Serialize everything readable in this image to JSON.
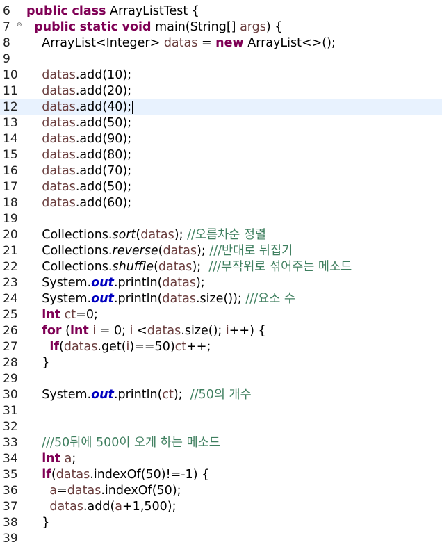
{
  "editor": {
    "current_line": "12",
    "lines": [
      {
        "num": "6",
        "segs": [
          [
            "kw",
            "public"
          ],
          [
            "t",
            " "
          ],
          [
            "kw",
            "class"
          ],
          [
            "t",
            " ArrayListTest {"
          ]
        ]
      },
      {
        "num": "7",
        "fold": true,
        "segs": [
          [
            "t",
            "  "
          ],
          [
            "kw",
            "public"
          ],
          [
            "t",
            " "
          ],
          [
            "kw",
            "static"
          ],
          [
            "t",
            " "
          ],
          [
            "kw",
            "void"
          ],
          [
            "t",
            " main(String[] "
          ],
          [
            "var",
            "args"
          ],
          [
            "t",
            ") {"
          ]
        ]
      },
      {
        "num": "8",
        "segs": [
          [
            "t",
            "    ArrayList<Integer> "
          ],
          [
            "var",
            "datas"
          ],
          [
            "t",
            " = "
          ],
          [
            "kw",
            "new"
          ],
          [
            "t",
            " ArrayList<>();"
          ]
        ]
      },
      {
        "num": "9",
        "segs": []
      },
      {
        "num": "10",
        "segs": [
          [
            "t",
            "    "
          ],
          [
            "var",
            "datas"
          ],
          [
            "t",
            ".add(10);"
          ]
        ]
      },
      {
        "num": "11",
        "segs": [
          [
            "t",
            "    "
          ],
          [
            "var",
            "datas"
          ],
          [
            "t",
            ".add(20);"
          ]
        ]
      },
      {
        "num": "12",
        "current": true,
        "caret": true,
        "segs": [
          [
            "t",
            "    "
          ],
          [
            "var",
            "datas"
          ],
          [
            "t",
            ".add(40);"
          ]
        ]
      },
      {
        "num": "13",
        "segs": [
          [
            "t",
            "    "
          ],
          [
            "var",
            "datas"
          ],
          [
            "t",
            ".add(50);"
          ]
        ]
      },
      {
        "num": "14",
        "segs": [
          [
            "t",
            "    "
          ],
          [
            "var",
            "datas"
          ],
          [
            "t",
            ".add(90);"
          ]
        ]
      },
      {
        "num": "15",
        "segs": [
          [
            "t",
            "    "
          ],
          [
            "var",
            "datas"
          ],
          [
            "t",
            ".add(80);"
          ]
        ]
      },
      {
        "num": "16",
        "segs": [
          [
            "t",
            "    "
          ],
          [
            "var",
            "datas"
          ],
          [
            "t",
            ".add(70);"
          ]
        ]
      },
      {
        "num": "17",
        "segs": [
          [
            "t",
            "    "
          ],
          [
            "var",
            "datas"
          ],
          [
            "t",
            ".add(50);"
          ]
        ]
      },
      {
        "num": "18",
        "segs": [
          [
            "t",
            "    "
          ],
          [
            "var",
            "datas"
          ],
          [
            "t",
            ".add(60);"
          ]
        ]
      },
      {
        "num": "19",
        "segs": []
      },
      {
        "num": "20",
        "segs": [
          [
            "t",
            "    Collections."
          ],
          [
            "sm",
            "sort"
          ],
          [
            "t",
            "("
          ],
          [
            "var",
            "datas"
          ],
          [
            "t",
            ");"
          ],
          [
            "t",
            " "
          ],
          [
            "cm",
            "//오름차순 정렬"
          ]
        ]
      },
      {
        "num": "21",
        "segs": [
          [
            "t",
            "    Collections."
          ],
          [
            "sm",
            "reverse"
          ],
          [
            "t",
            "("
          ],
          [
            "var",
            "datas"
          ],
          [
            "t",
            ");"
          ],
          [
            "t",
            " "
          ],
          [
            "cm",
            "///반대로 뒤집기"
          ]
        ]
      },
      {
        "num": "22",
        "segs": [
          [
            "t",
            "    Collections."
          ],
          [
            "sm",
            "shuffle"
          ],
          [
            "t",
            "("
          ],
          [
            "var",
            "datas"
          ],
          [
            "t",
            ");"
          ],
          [
            "t",
            "  "
          ],
          [
            "cm",
            "///무작위로 섞어주는 메소드"
          ]
        ]
      },
      {
        "num": "23",
        "segs": [
          [
            "t",
            "    System."
          ],
          [
            "fld",
            "out"
          ],
          [
            "t",
            ".println("
          ],
          [
            "var",
            "datas"
          ],
          [
            "t",
            ");"
          ]
        ]
      },
      {
        "num": "24",
        "segs": [
          [
            "t",
            "    System."
          ],
          [
            "fld",
            "out"
          ],
          [
            "t",
            ".println("
          ],
          [
            "var",
            "datas"
          ],
          [
            "t",
            ".size());"
          ],
          [
            "t",
            " "
          ],
          [
            "cm",
            "///요소 수"
          ]
        ]
      },
      {
        "num": "25",
        "segs": [
          [
            "t",
            "    "
          ],
          [
            "kw",
            "int"
          ],
          [
            "t",
            " "
          ],
          [
            "var",
            "ct"
          ],
          [
            "t",
            "=0;"
          ]
        ]
      },
      {
        "num": "26",
        "segs": [
          [
            "t",
            "    "
          ],
          [
            "kw",
            "for"
          ],
          [
            "t",
            " ("
          ],
          [
            "kw",
            "int"
          ],
          [
            "t",
            " "
          ],
          [
            "var",
            "i"
          ],
          [
            "t",
            " = 0; "
          ],
          [
            "var",
            "i"
          ],
          [
            "t",
            " <"
          ],
          [
            "var",
            "datas"
          ],
          [
            "t",
            ".size(); "
          ],
          [
            "var",
            "i"
          ],
          [
            "t",
            "++) {"
          ]
        ]
      },
      {
        "num": "27",
        "segs": [
          [
            "t",
            "      "
          ],
          [
            "kw",
            "if"
          ],
          [
            "t",
            "("
          ],
          [
            "var",
            "datas"
          ],
          [
            "t",
            ".get("
          ],
          [
            "var",
            "i"
          ],
          [
            "t",
            ")==50)"
          ],
          [
            "var",
            "ct"
          ],
          [
            "t",
            "++;"
          ]
        ]
      },
      {
        "num": "28",
        "segs": [
          [
            "t",
            "    }"
          ]
        ]
      },
      {
        "num": "29",
        "segs": []
      },
      {
        "num": "30",
        "segs": [
          [
            "t",
            "    System."
          ],
          [
            "fld",
            "out"
          ],
          [
            "t",
            ".println("
          ],
          [
            "var",
            "ct"
          ],
          [
            "t",
            ");"
          ],
          [
            "t",
            "  "
          ],
          [
            "cm",
            "//50의 개수"
          ]
        ]
      },
      {
        "num": "31",
        "segs": []
      },
      {
        "num": "32",
        "segs": []
      },
      {
        "num": "33",
        "segs": [
          [
            "t",
            "    "
          ],
          [
            "cm",
            "///50뒤에 500이 오게 하는 메소드"
          ]
        ]
      },
      {
        "num": "34",
        "segs": [
          [
            "t",
            "    "
          ],
          [
            "kw",
            "int"
          ],
          [
            "t",
            " "
          ],
          [
            "var",
            "a"
          ],
          [
            "t",
            ";"
          ]
        ]
      },
      {
        "num": "35",
        "segs": [
          [
            "t",
            "    "
          ],
          [
            "kw",
            "if"
          ],
          [
            "t",
            "("
          ],
          [
            "var",
            "datas"
          ],
          [
            "t",
            ".indexOf(50)!=-1) {"
          ]
        ]
      },
      {
        "num": "36",
        "segs": [
          [
            "t",
            "      "
          ],
          [
            "var",
            "a"
          ],
          [
            "t",
            "="
          ],
          [
            "var",
            "datas"
          ],
          [
            "t",
            ".indexOf(50);"
          ]
        ]
      },
      {
        "num": "37",
        "segs": [
          [
            "t",
            "      "
          ],
          [
            "var",
            "datas"
          ],
          [
            "t",
            ".add("
          ],
          [
            "var",
            "a"
          ],
          [
            "t",
            "+1,500);"
          ]
        ]
      },
      {
        "num": "38",
        "segs": [
          [
            "t",
            "    }"
          ]
        ]
      },
      {
        "num": "39",
        "segs": []
      }
    ]
  },
  "colors": {
    "keyword": "#7f0055",
    "local_variable": "#6a3e3e",
    "static_field": "#0000c0",
    "comment": "#3f7f5f",
    "current_line_highlight": "#e8f2fe"
  }
}
